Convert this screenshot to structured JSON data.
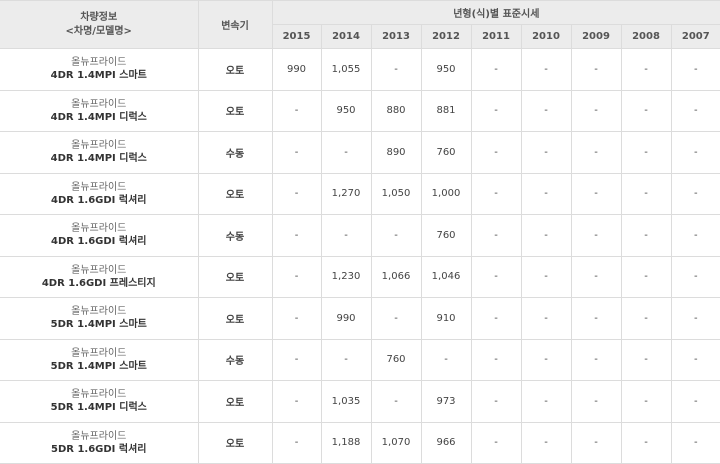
{
  "header": {
    "info_title": "차량정보",
    "info_subtitle": "<차명/모델명>",
    "transmission": "변속기",
    "year_group": "년형(식)별 표준시세",
    "years": [
      "2015",
      "2014",
      "2013",
      "2012",
      "2011",
      "2010",
      "2009",
      "2008",
      "2007"
    ]
  },
  "rows": [
    {
      "name": "올뉴프라이드",
      "model": "4DR 1.4MPI 스마트",
      "trans": "오토",
      "prices": [
        "990",
        "1,055",
        "-",
        "950",
        "-",
        "-",
        "-",
        "-",
        "-"
      ]
    },
    {
      "name": "올뉴프라이드",
      "model": "4DR 1.4MPI 디럭스",
      "trans": "오토",
      "prices": [
        "-",
        "950",
        "880",
        "881",
        "-",
        "-",
        "-",
        "-",
        "-"
      ]
    },
    {
      "name": "올뉴프라이드",
      "model": "4DR 1.4MPI 디럭스",
      "trans": "수동",
      "prices": [
        "-",
        "-",
        "890",
        "760",
        "-",
        "-",
        "-",
        "-",
        "-"
      ]
    },
    {
      "name": "올뉴프라이드",
      "model": "4DR 1.6GDI 럭셔리",
      "trans": "오토",
      "prices": [
        "-",
        "1,270",
        "1,050",
        "1,000",
        "-",
        "-",
        "-",
        "-",
        "-"
      ]
    },
    {
      "name": "올뉴프라이드",
      "model": "4DR 1.6GDI 럭셔리",
      "trans": "수동",
      "prices": [
        "-",
        "-",
        "-",
        "760",
        "-",
        "-",
        "-",
        "-",
        "-"
      ]
    },
    {
      "name": "올뉴프라이드",
      "model": "4DR 1.6GDI 프레스티지",
      "trans": "오토",
      "prices": [
        "-",
        "1,230",
        "1,066",
        "1,046",
        "-",
        "-",
        "-",
        "-",
        "-"
      ]
    },
    {
      "name": "올뉴프라이드",
      "model": "5DR 1.4MPI 스마트",
      "trans": "오토",
      "prices": [
        "-",
        "990",
        "-",
        "910",
        "-",
        "-",
        "-",
        "-",
        "-"
      ]
    },
    {
      "name": "올뉴프라이드",
      "model": "5DR 1.4MPI 스마트",
      "trans": "수동",
      "prices": [
        "-",
        "-",
        "760",
        "-",
        "-",
        "-",
        "-",
        "-",
        "-"
      ]
    },
    {
      "name": "올뉴프라이드",
      "model": "5DR 1.4MPI 디럭스",
      "trans": "오토",
      "prices": [
        "-",
        "1,035",
        "-",
        "973",
        "-",
        "-",
        "-",
        "-",
        "-"
      ]
    },
    {
      "name": "올뉴프라이드",
      "model": "5DR 1.6GDI 럭셔리",
      "trans": "오토",
      "prices": [
        "-",
        "1,188",
        "1,070",
        "966",
        "-",
        "-",
        "-",
        "-",
        "-"
      ]
    }
  ]
}
